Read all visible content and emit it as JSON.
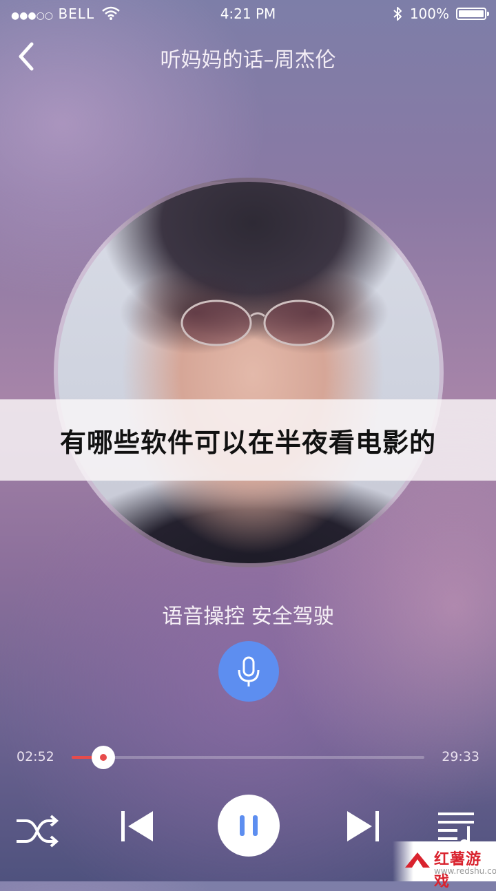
{
  "status_bar": {
    "signal_dots": "●●●○○",
    "carrier": "BELL",
    "time": "4:21 PM",
    "battery": "100%"
  },
  "header": {
    "title": "听妈妈的话–周杰伦"
  },
  "banner": {
    "text": "有哪些软件可以在半夜看电影的"
  },
  "voice": {
    "label": "语音操控 安全驾驶"
  },
  "player": {
    "current_time": "02:52",
    "total_time": "29:33",
    "progress": 0.09,
    "state": "playing"
  },
  "watermark": {
    "name": "红薯游戏",
    "url": "www.redshu.com"
  },
  "colors": {
    "accent_blue": "#5d8ef0",
    "progress_red": "#e74b4b"
  }
}
